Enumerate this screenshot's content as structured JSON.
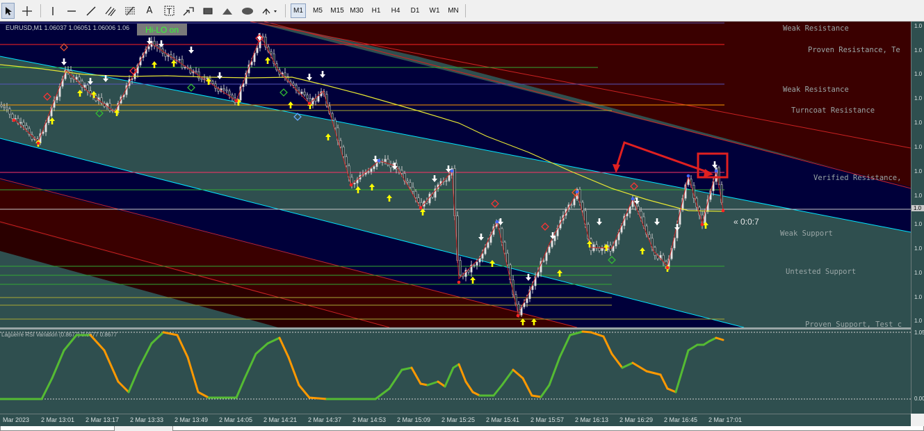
{
  "toolbar": {
    "tools": [
      {
        "icon": "cursor-arrow-icon",
        "selected": true
      },
      {
        "icon": "crosshair-icon"
      },
      {
        "icon": "vertical-line-icon"
      },
      {
        "icon": "horizontal-line-icon"
      },
      {
        "icon": "trendline-icon"
      },
      {
        "icon": "equidistant-channel-icon"
      },
      {
        "icon": "fibonacci-retracement-icon"
      },
      {
        "icon": "text-icon",
        "glyph": "A"
      },
      {
        "icon": "text-label-icon",
        "glyph": "T"
      },
      {
        "icon": "arrows-icon"
      },
      {
        "icon": "rectangle-icon"
      },
      {
        "icon": "triangle-icon"
      },
      {
        "icon": "ellipse-icon"
      },
      {
        "icon": "more-shapes-icon"
      }
    ],
    "timeframes": [
      "M1",
      "M5",
      "M15",
      "M30",
      "H1",
      "H4",
      "D1",
      "W1",
      "MN"
    ],
    "active_timeframe": "M1"
  },
  "chart": {
    "symbol_info": "EURUSD,M1  1.06037 1.06051 1.06006 1.06",
    "hilo_button": "Hi-LO on",
    "timer": "« 0:0:7",
    "zone_labels": [
      {
        "text": "Weak Resistance"
      },
      {
        "text": "Proven Resistance, Te"
      },
      {
        "text": "Weak Resistance"
      },
      {
        "text": "Turncoat Resistance"
      },
      {
        "text": "Verified Resistance,"
      },
      {
        "text": "Weak Support"
      },
      {
        "text": "Untested Support"
      },
      {
        "text": "Proven Support, Test c"
      }
    ],
    "price_ticks": [
      "1.0",
      "1.0",
      "1.0",
      "1.0",
      "1.0",
      "1.0",
      "1.0",
      "1.0",
      "1.0",
      "1.0",
      "1.0",
      "1.0",
      "1.0",
      "1.0"
    ],
    "colors": {
      "background": "#2f4f4f",
      "channel_blue": "#00003a",
      "channel_red": "#3a0000",
      "moving_average": "#e6e633",
      "bullish_marker": "#ffff00",
      "bearish_marker": "#ffffff",
      "annotation": "#e02020"
    }
  },
  "indicator": {
    "title": "Laguerre RSI Variation (0.8677) 0.8677 0.8677",
    "scale_top": "1.05",
    "scale_bottom": "0.00",
    "colors": {
      "rising": "#55bb33",
      "falling": "#ff9900",
      "levels": "#d0d0d0"
    }
  },
  "time_axis": {
    "labels": [
      "Mar 2023",
      "2 Mar 13:01",
      "2 Mar 13:17",
      "2 Mar 13:33",
      "2 Mar 13:49",
      "2 Mar 14:05",
      "2 Mar 14:21",
      "2 Mar 14:37",
      "2 Mar 14:53",
      "2 Mar 15:09",
      "2 Mar 15:25",
      "2 Mar 15:41",
      "2 Mar 15:57",
      "2 Mar 16:13",
      "2 Mar 16:29",
      "2 Mar 16:45",
      "2 Mar 17:01"
    ]
  }
}
